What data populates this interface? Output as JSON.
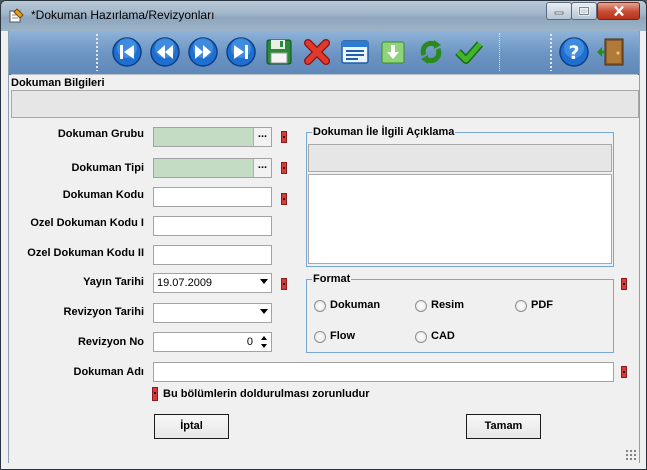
{
  "window": {
    "title": "*Dokuman Hazırlama/Revizyonları",
    "app_icon": "pencil-notepad-icon",
    "caption_buttons": [
      "minimize-icon",
      "maximize-icon",
      "close-icon"
    ]
  },
  "toolbar": {
    "buttons": [
      {
        "name": "first-record-button",
        "icon": "first-record-icon"
      },
      {
        "name": "previous-record-button",
        "icon": "previous-record-icon"
      },
      {
        "name": "next-record-button",
        "icon": "next-record-icon"
      },
      {
        "name": "last-record-button",
        "icon": "last-record-icon"
      },
      {
        "name": "save-button",
        "icon": "floppy-disk-icon"
      },
      {
        "name": "delete-button",
        "icon": "red-x-icon"
      },
      {
        "name": "list-view-button",
        "icon": "window-list-icon"
      },
      {
        "name": "download-button",
        "icon": "green-download-icon"
      },
      {
        "name": "refresh-button",
        "icon": "green-cycle-icon"
      },
      {
        "name": "confirm-button",
        "icon": "green-check-icon"
      },
      {
        "name": "help-button",
        "icon": "help-question-icon"
      },
      {
        "name": "exit-button",
        "icon": "exit-door-icon"
      }
    ]
  },
  "section": {
    "title": "Dokuman Bilgileri"
  },
  "form": {
    "dokuman_grubu": {
      "label": "Dokuman Grubu",
      "value": "",
      "ellipsis": "..."
    },
    "dokuman_tipi": {
      "label": "Dokuman Tipi",
      "value": "",
      "ellipsis": "..."
    },
    "dokuman_kodu": {
      "label": "Dokuman Kodu",
      "value": ""
    },
    "ozel_kodu_1": {
      "label": "Ozel Dokuman Kodu I",
      "value": ""
    },
    "ozel_kodu_2": {
      "label": "Ozel Dokuman Kodu II",
      "value": ""
    },
    "yayin_tarihi": {
      "label": "Yayın Tarihi",
      "value": "19.07.2009"
    },
    "revizyon_tarihi": {
      "label": "Revizyon Tarihi",
      "value": ""
    },
    "revizyon_no": {
      "label": "Revizyon No",
      "value": "0"
    },
    "dokuman_adi": {
      "label": "Dokuman Adı",
      "value": ""
    }
  },
  "aciklama": {
    "title": "Dokuman İle İlgili Açıklama",
    "header_value": "",
    "body_value": ""
  },
  "format": {
    "title": "Format",
    "options": [
      "Dokuman",
      "Resim",
      "PDF",
      "Flow",
      "CAD"
    ],
    "selected": ""
  },
  "required_note": "Bu bölümlerin doldurulması zorunludur",
  "buttons": {
    "cancel": "İptal",
    "ok": "Tamam"
  },
  "colors": {
    "toolbar": "#6e96c4",
    "required": "#d63b3b",
    "lookup_field": "#c4dcc4",
    "groupbox_border": "#7aa6d6"
  }
}
